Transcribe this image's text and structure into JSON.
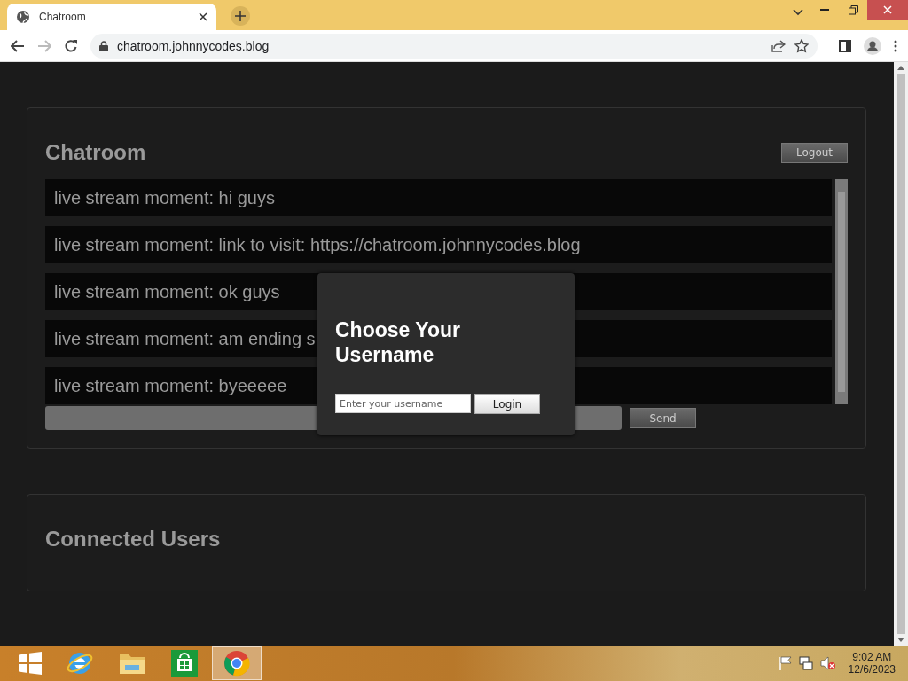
{
  "browser": {
    "tab": {
      "title": "Chatroom"
    },
    "url": "chatroom.johnnycodes.blog"
  },
  "chatroom": {
    "title": "Chatroom",
    "logout": "Logout",
    "messages": [
      {
        "text": "live stream moment: hi guys"
      },
      {
        "text": "live stream moment: link to visit: https://chatroom.johnnycodes.blog"
      },
      {
        "text": "live stream moment: ok guys"
      },
      {
        "text": "live stream moment: am ending s"
      },
      {
        "text": "live stream moment: byeeeee"
      }
    ],
    "send": "Send"
  },
  "connected_users": {
    "title": "Connected Users"
  },
  "modal": {
    "title": "Choose Your Username",
    "placeholder": "Enter your username",
    "login": "Login"
  },
  "taskbar": {
    "apps": [
      {
        "kind": "ie",
        "selected": false
      },
      {
        "kind": "folder",
        "selected": false
      },
      {
        "kind": "store",
        "selected": false
      },
      {
        "kind": "chrome",
        "selected": true
      }
    ],
    "time": "9:02 AM",
    "date": "12/6/2023"
  }
}
